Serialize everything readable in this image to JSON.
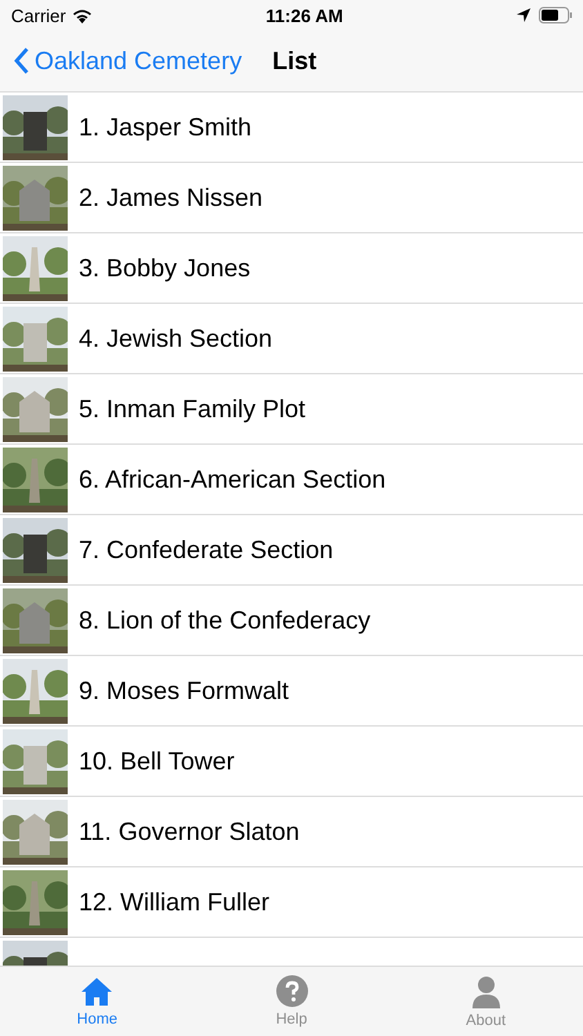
{
  "status_bar": {
    "carrier": "Carrier",
    "time": "11:26 AM"
  },
  "nav_bar": {
    "back": "Oakland Cemetery",
    "title": "List"
  },
  "list": [
    {
      "kind": "entry",
      "label": "1. Jasper Smith"
    },
    {
      "kind": "entry",
      "label": "2. James Nissen"
    },
    {
      "kind": "entry",
      "label": "3. Bobby Jones"
    },
    {
      "kind": "entry",
      "label": "4. Jewish Section"
    },
    {
      "kind": "entry",
      "label": "5. Inman Family Plot"
    },
    {
      "kind": "entry",
      "label": "6. African-American Section"
    },
    {
      "kind": "entry",
      "label": "7. Confederate Section"
    },
    {
      "kind": "entry",
      "label": "8. Lion of the Confederacy"
    },
    {
      "kind": "entry",
      "label": "9. Moses Formwalt"
    },
    {
      "kind": "entry",
      "label": "10. Bell Tower"
    },
    {
      "kind": "entry",
      "label": "11. Governor Slaton"
    },
    {
      "kind": "entry",
      "label": "12. William Fuller"
    },
    {
      "kind": "picture"
    }
  ],
  "tab_bar": [
    {
      "kind": "home",
      "label": "Home",
      "selected": true
    },
    {
      "kind": "help",
      "label": "Help",
      "selected": false
    },
    {
      "kind": "person",
      "label": "About",
      "selected": false
    }
  ]
}
